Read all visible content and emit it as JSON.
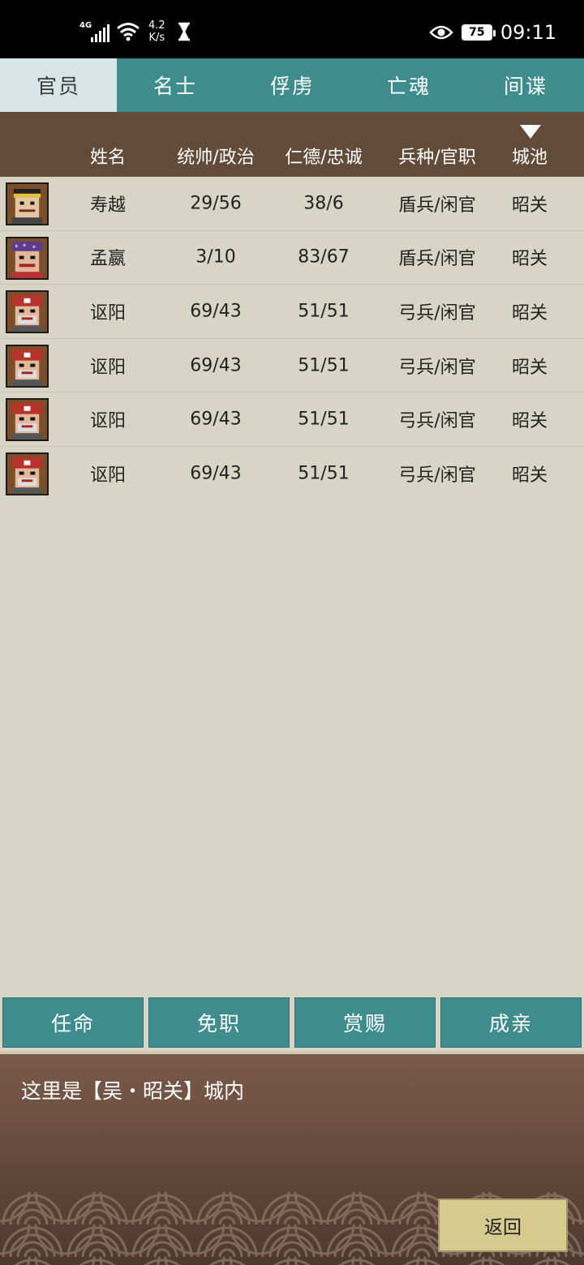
{
  "status_bar": {
    "network": "4G",
    "speed_value": "4.2",
    "speed_unit": "K/s",
    "battery": "75",
    "time": "09:11",
    "icons": [
      "signal-icon",
      "wifi-icon",
      "hourglass-icon",
      "eye-icon",
      "battery-icon"
    ]
  },
  "tabs": [
    {
      "label": "官员",
      "active": true
    },
    {
      "label": "名士",
      "active": false
    },
    {
      "label": "俘虏",
      "active": false
    },
    {
      "label": "亡魂",
      "active": false
    },
    {
      "label": "间谍",
      "active": false
    }
  ],
  "table": {
    "headers": {
      "name": "姓名",
      "command_politics": "统帅/政治",
      "virtue_loyalty": "仁德/忠诚",
      "troop_post": "兵种/官职",
      "city": "城池"
    },
    "rows": [
      {
        "name": "寿越",
        "cp": "29/56",
        "vl": "38/6",
        "tp": "盾兵/闲官",
        "city": "昭关",
        "avatar": "yellow-headband"
      },
      {
        "name": "孟嬴",
        "cp": "3/10",
        "vl": "83/67",
        "tp": "盾兵/闲官",
        "city": "昭关",
        "avatar": "purple-hat"
      },
      {
        "name": "讴阳",
        "cp": "69/43",
        "vl": "51/51",
        "tp": "弓兵/闲官",
        "city": "昭关",
        "avatar": "red-helmet"
      },
      {
        "name": "讴阳",
        "cp": "69/43",
        "vl": "51/51",
        "tp": "弓兵/闲官",
        "city": "昭关",
        "avatar": "red-helmet"
      },
      {
        "name": "讴阳",
        "cp": "69/43",
        "vl": "51/51",
        "tp": "弓兵/闲官",
        "city": "昭关",
        "avatar": "red-helmet"
      },
      {
        "name": "讴阳",
        "cp": "69/43",
        "vl": "51/51",
        "tp": "弓兵/闲官",
        "city": "昭关",
        "avatar": "red-helmet"
      }
    ]
  },
  "actions": [
    "任命",
    "免职",
    "赏赐",
    "成亲"
  ],
  "footer": {
    "message": "这里是【吴・昭关】城内",
    "return_label": "返回"
  },
  "colors": {
    "teal": "#3e8c8e",
    "header_brown": "#634b3a",
    "background": "#d8d5c6",
    "return_gold": "#d6ca8e"
  }
}
